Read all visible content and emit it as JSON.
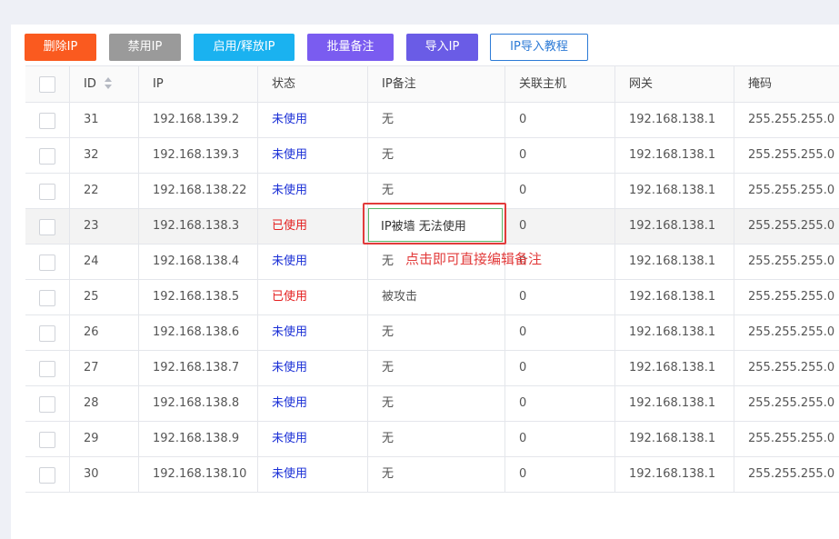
{
  "toolbar": {
    "delete_ip": "删除IP",
    "disable_ip": "禁用IP",
    "enable_release": "启用/释放IP",
    "batch_note": "批量备注",
    "import_ip": "导入IP",
    "import_tutorial": "IP导入教程"
  },
  "colors": {
    "delete": "#fa5a1f",
    "disable": "#9a9a9a",
    "enable": "#1ab2f0",
    "batch": "#7a5cf0",
    "import": "#6a5ce6",
    "status_unused": "#1a2fd6",
    "status_used": "#e42020",
    "annotation": "#e23b3b"
  },
  "table": {
    "columns": [
      "ID",
      "IP",
      "状态",
      "IP备注",
      "关联主机",
      "网关",
      "掩码"
    ],
    "rows": [
      {
        "id": "31",
        "ip": "192.168.139.2",
        "status": "未使用",
        "note": "无",
        "host": "0",
        "gateway": "192.168.138.1",
        "mask": "255.255.255.0"
      },
      {
        "id": "32",
        "ip": "192.168.139.3",
        "status": "未使用",
        "note": "无",
        "host": "0",
        "gateway": "192.168.138.1",
        "mask": "255.255.255.0"
      },
      {
        "id": "22",
        "ip": "192.168.138.22",
        "status": "未使用",
        "note": "无",
        "host": "0",
        "gateway": "192.168.138.1",
        "mask": "255.255.255.0"
      },
      {
        "id": "23",
        "ip": "192.168.138.3",
        "status": "已使用",
        "note": "IP被墙 无法使用",
        "host": "0",
        "gateway": "192.168.138.1",
        "mask": "255.255.255.0"
      },
      {
        "id": "24",
        "ip": "192.168.138.4",
        "status": "未使用",
        "note": "无",
        "host": "0",
        "gateway": "192.168.138.1",
        "mask": "255.255.255.0"
      },
      {
        "id": "25",
        "ip": "192.168.138.5",
        "status": "已使用",
        "note": "被攻击",
        "host": "0",
        "gateway": "192.168.138.1",
        "mask": "255.255.255.0"
      },
      {
        "id": "26",
        "ip": "192.168.138.6",
        "status": "未使用",
        "note": "无",
        "host": "0",
        "gateway": "192.168.138.1",
        "mask": "255.255.255.0"
      },
      {
        "id": "27",
        "ip": "192.168.138.7",
        "status": "未使用",
        "note": "无",
        "host": "0",
        "gateway": "192.168.138.1",
        "mask": "255.255.255.0"
      },
      {
        "id": "28",
        "ip": "192.168.138.8",
        "status": "未使用",
        "note": "无",
        "host": "0",
        "gateway": "192.168.138.1",
        "mask": "255.255.255.0"
      },
      {
        "id": "29",
        "ip": "192.168.138.9",
        "status": "未使用",
        "note": "无",
        "host": "0",
        "gateway": "192.168.138.1",
        "mask": "255.255.255.0"
      },
      {
        "id": "30",
        "ip": "192.168.138.10",
        "status": "未使用",
        "note": "无",
        "host": "0",
        "gateway": "192.168.138.1",
        "mask": "255.255.255.0"
      }
    ]
  },
  "annotation": {
    "text": "点击即可直接编辑备注"
  }
}
